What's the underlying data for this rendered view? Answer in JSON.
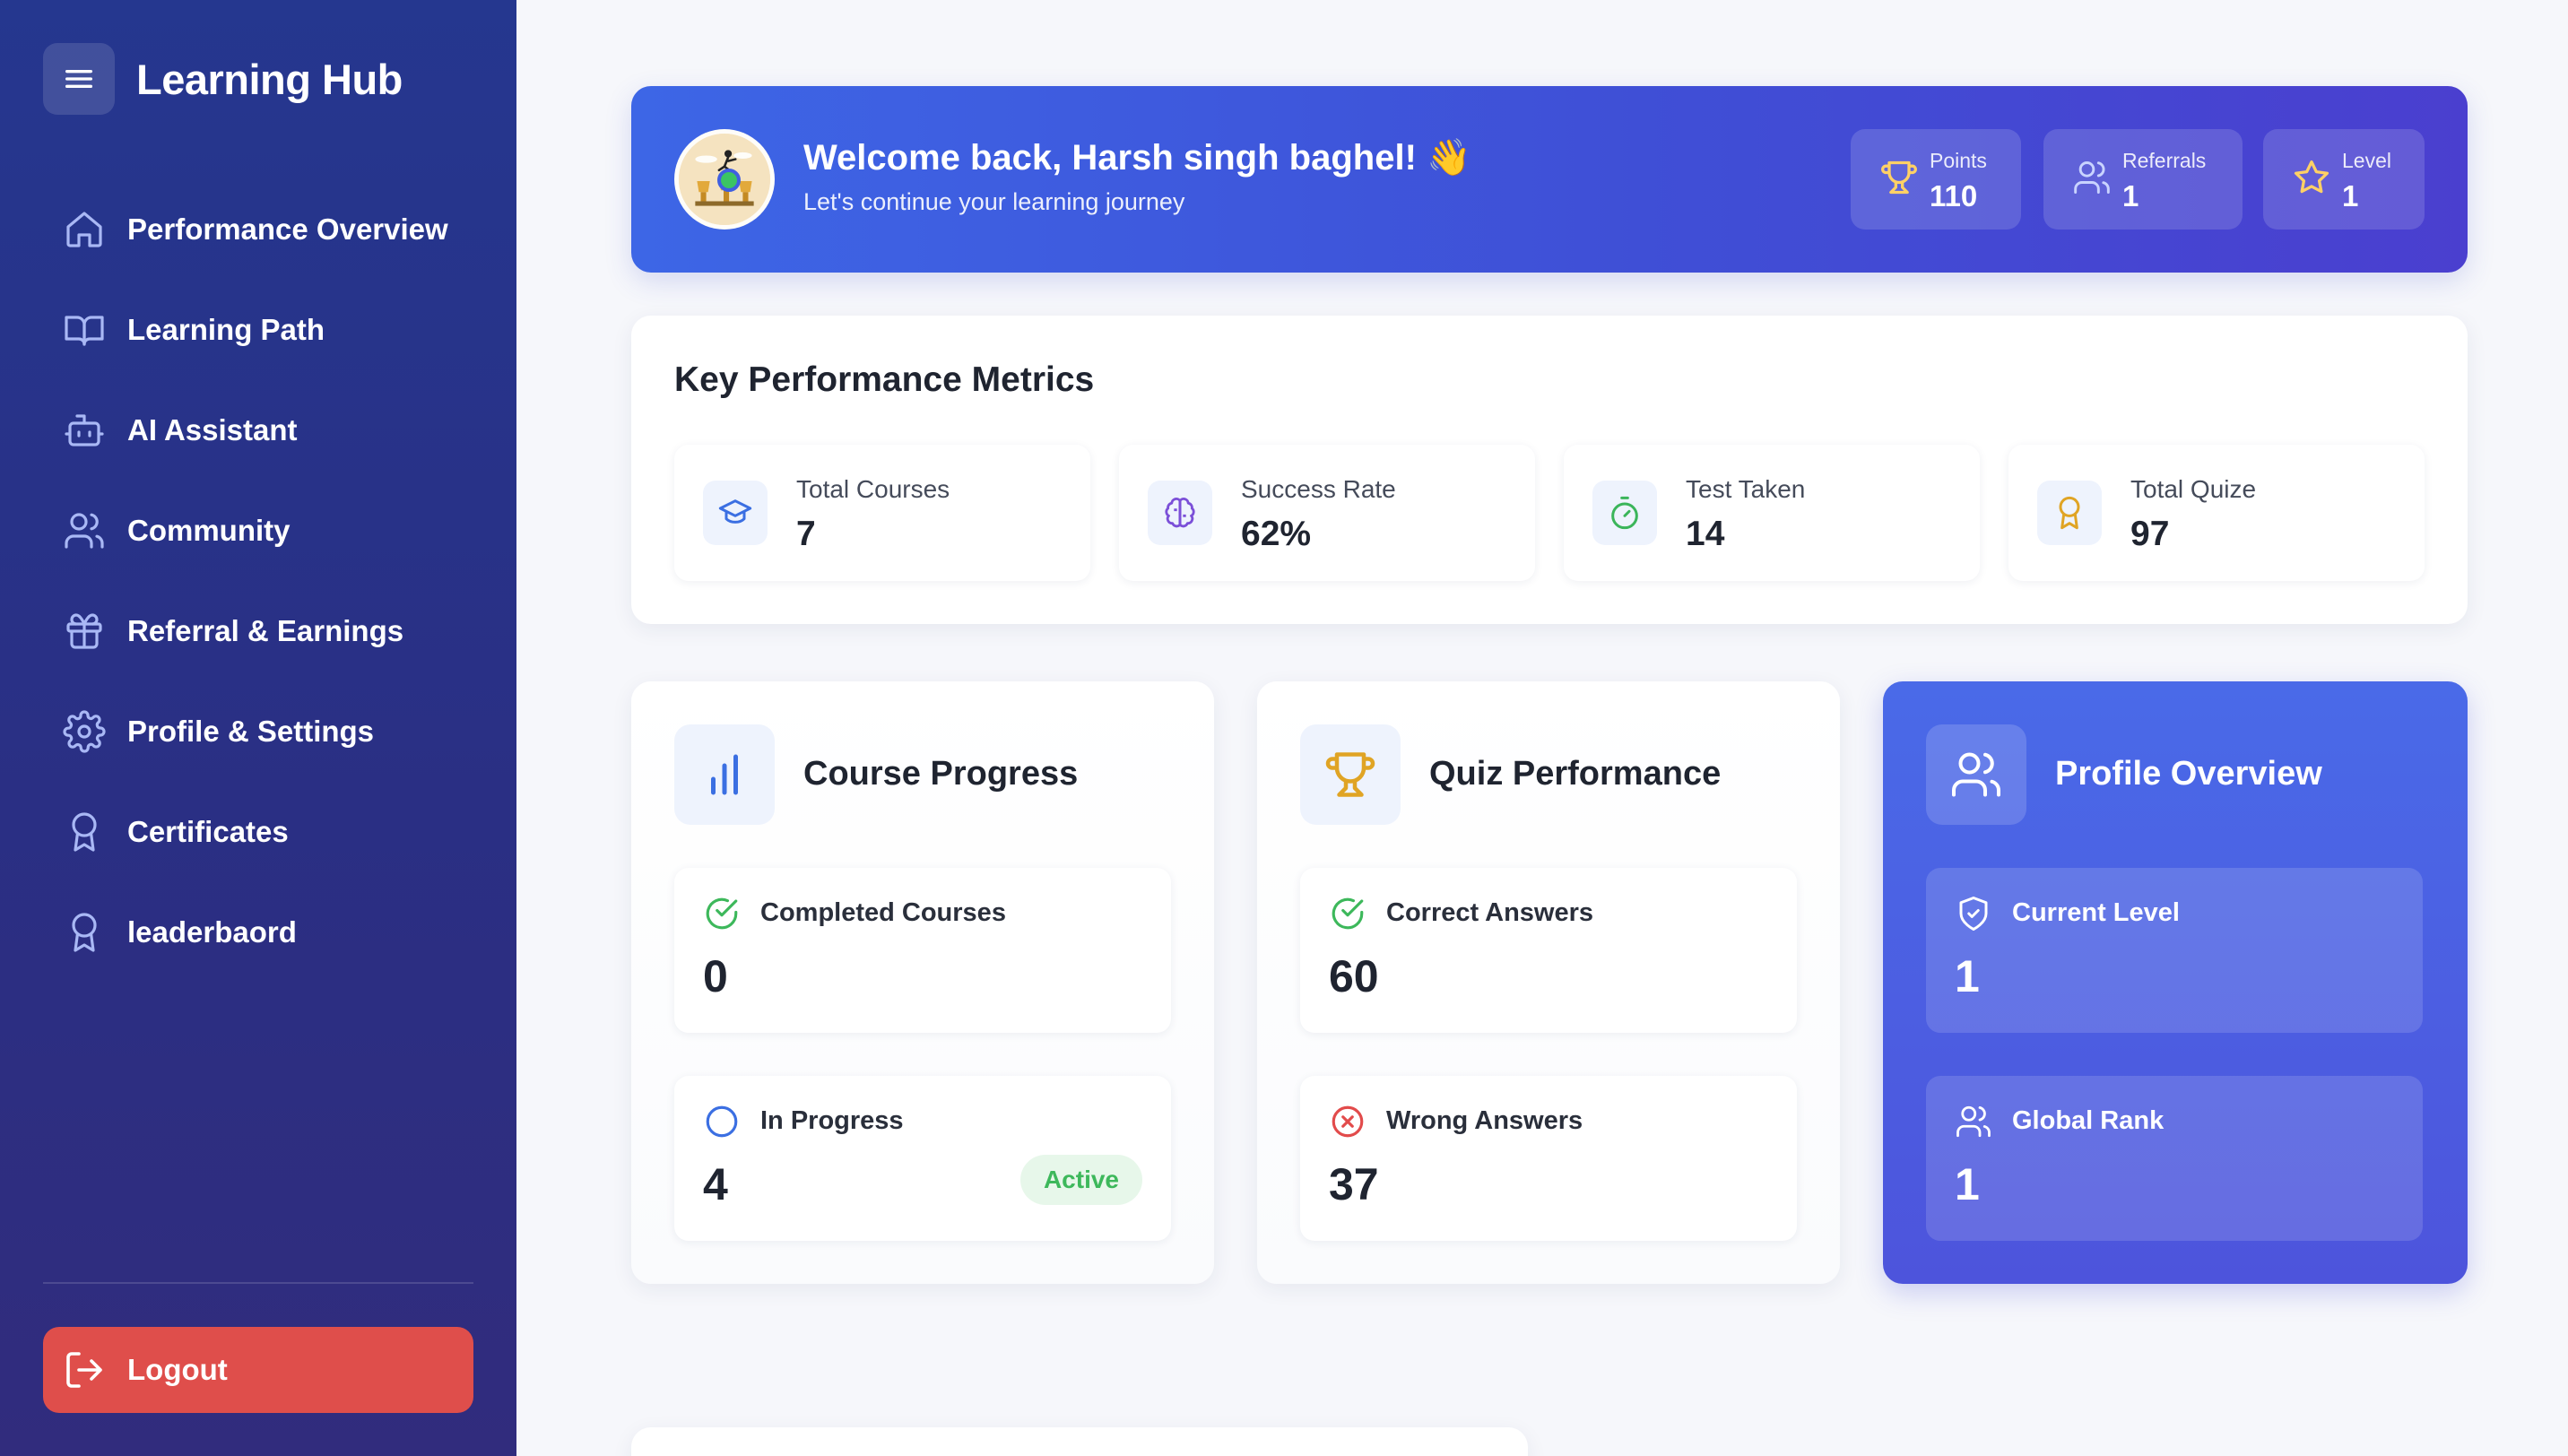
{
  "sidebar": {
    "brand": "Learning Hub",
    "items": [
      {
        "label": "Performance Overview",
        "icon": "home-icon"
      },
      {
        "label": "Learning Path",
        "icon": "book-icon"
      },
      {
        "label": "AI Assistant",
        "icon": "bot-icon"
      },
      {
        "label": "Community",
        "icon": "users-icon"
      },
      {
        "label": "Referral & Earnings",
        "icon": "gift-icon"
      },
      {
        "label": "Profile & Settings",
        "icon": "gear-icon"
      },
      {
        "label": "Certificates",
        "icon": "award-icon"
      },
      {
        "label": "leaderbaord",
        "icon": "award-icon"
      }
    ],
    "logout": "Logout"
  },
  "banner": {
    "title": "Welcome back, Harsh singh baghel! 👋",
    "subtitle": "Let's continue your learning journey",
    "stats": [
      {
        "label": "Points",
        "value": "110",
        "icon": "trophy-icon"
      },
      {
        "label": "Referrals",
        "value": "1",
        "icon": "users-icon"
      },
      {
        "label": "Level",
        "value": "1",
        "icon": "star-icon"
      }
    ]
  },
  "kpi": {
    "title": "Key Performance Metrics",
    "items": [
      {
        "label": "Total Courses",
        "value": "7",
        "icon": "graduation-cap-icon"
      },
      {
        "label": "Success Rate",
        "value": "62%",
        "icon": "brain-icon"
      },
      {
        "label": "Test Taken",
        "value": "14",
        "icon": "timer-icon"
      },
      {
        "label": "Total Quize",
        "value": "97",
        "icon": "award-icon"
      }
    ]
  },
  "course_progress": {
    "title": "Course Progress",
    "completed_label": "Completed Courses",
    "completed_value": "0",
    "in_progress_label": "In Progress",
    "in_progress_value": "4",
    "badge": "Active"
  },
  "quiz_performance": {
    "title": "Quiz Performance",
    "correct_label": "Correct Answers",
    "correct_value": "60",
    "wrong_label": "Wrong Answers",
    "wrong_value": "37"
  },
  "profile_overview": {
    "title": "Profile Overview",
    "level_label": "Current Level",
    "level_value": "1",
    "rank_label": "Global Rank",
    "rank_value": "1"
  },
  "colors": {
    "sidebar": "#2a2f84",
    "banner": "#3f4fd6",
    "logout": "#df4e4b",
    "success": "#3db85b",
    "danger": "#e24b4b",
    "accent": "#4a6ae8"
  }
}
